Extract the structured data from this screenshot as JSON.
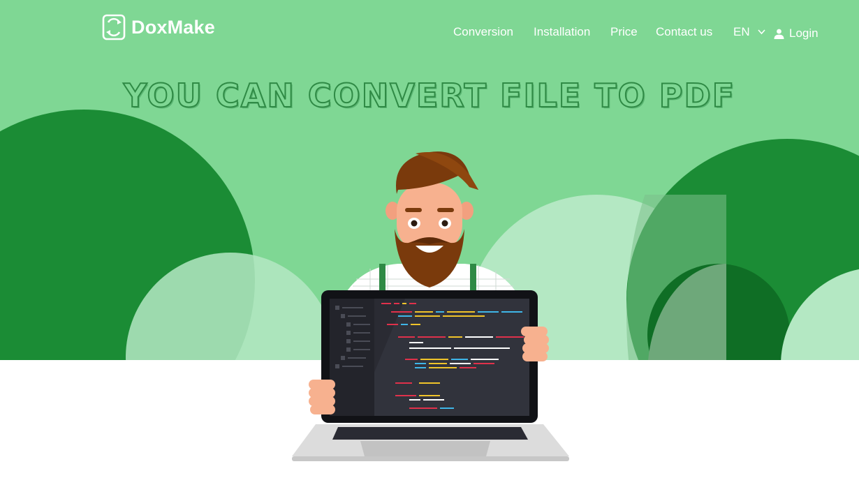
{
  "brand": {
    "name": "DoxMake",
    "icon": "doxmake-logo-icon"
  },
  "nav": {
    "items": [
      {
        "label": "Conversion"
      },
      {
        "label": "Installation"
      },
      {
        "label": "Price"
      },
      {
        "label": "Contact us"
      }
    ],
    "language": {
      "selected": "EN",
      "icon": "chevron-down-icon"
    },
    "login": {
      "label": "Login",
      "icon": "user-icon"
    }
  },
  "hero": {
    "headline": "YOU CAN CONVERT FILE TO PDF",
    "illustration": "bearded-man-holding-laptop-with-code"
  },
  "colors": {
    "hero_background": "#7fd794",
    "dark_green": "#1b8c35",
    "light_green": "#b4e8c3",
    "text": "#ffffff"
  }
}
